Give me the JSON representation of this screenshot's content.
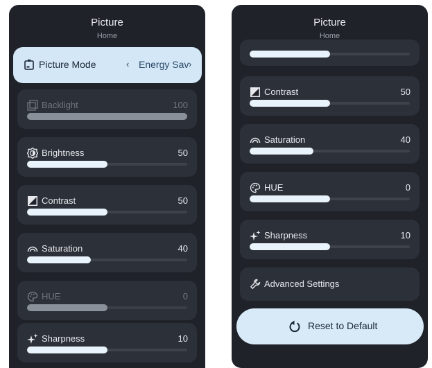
{
  "left": {
    "title": "Picture",
    "subtitle": "Home",
    "picture_mode": {
      "label": "Picture Mode",
      "value": "Energy Sav",
      "left_arrow": "‹",
      "right_arrow": "›"
    },
    "settings": [
      {
        "label": "Backlight",
        "value": "100",
        "level": 1.0,
        "icon": "backlight-icon",
        "disabled": true
      },
      {
        "label": "Brightness",
        "value": "50",
        "level": 0.5,
        "icon": "brightness-icon",
        "disabled": false
      },
      {
        "label": "Contrast",
        "value": "50",
        "level": 0.5,
        "icon": "contrast-icon",
        "disabled": false
      },
      {
        "label": "Saturation",
        "value": "40",
        "level": 0.4,
        "icon": "saturation-icon",
        "disabled": false
      },
      {
        "label": "HUE",
        "value": "0",
        "level": 0.5,
        "icon": "palette-icon",
        "disabled": true
      },
      {
        "label": "Sharpness",
        "value": "10",
        "level": 0.5,
        "icon": "sparkle-icon",
        "disabled": false
      }
    ]
  },
  "right": {
    "title": "Picture",
    "subtitle": "Home",
    "settings": [
      {
        "label": "Contrast",
        "value": "50",
        "level": 0.5,
        "icon": "contrast-icon"
      },
      {
        "label": "Saturation",
        "value": "40",
        "level": 0.4,
        "icon": "saturation-icon"
      },
      {
        "label": "HUE",
        "value": "0",
        "level": 0.5,
        "icon": "palette-icon"
      },
      {
        "label": "Sharpness",
        "value": "10",
        "level": 0.5,
        "icon": "sparkle-icon"
      }
    ],
    "advanced_label": "Advanced Settings",
    "reset_label": "Reset to Default"
  },
  "colors": {
    "panel": "#1f2229",
    "card": "#2c3038",
    "accent": "#d3e7f7",
    "fill": "#e9f3fb"
  }
}
